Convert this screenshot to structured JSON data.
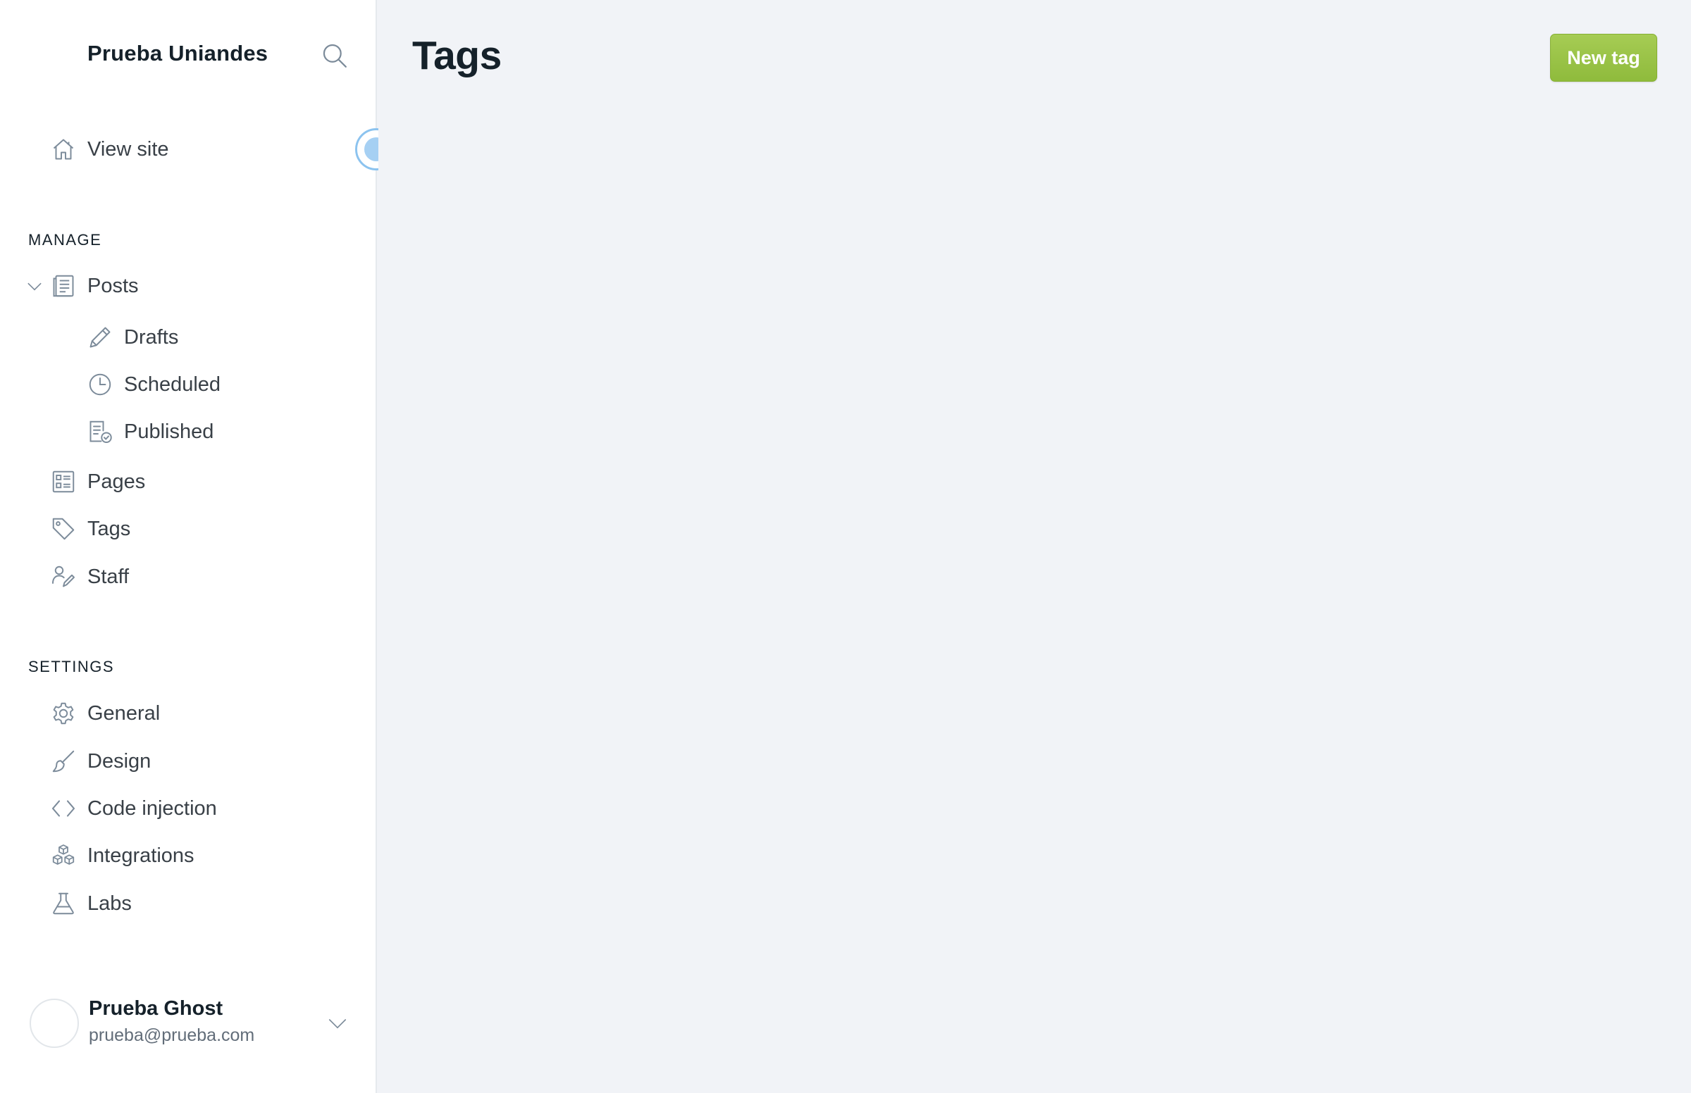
{
  "sidebar": {
    "site_title": "Prueba Uniandes",
    "view_site": "View site",
    "manage_label": "MANAGE",
    "posts": "Posts",
    "drafts": "Drafts",
    "scheduled": "Scheduled",
    "published": "Published",
    "pages": "Pages",
    "tags": "Tags",
    "staff": "Staff",
    "settings_label": "SETTINGS",
    "general": "General",
    "design": "Design",
    "code_injection": "Code injection",
    "integrations": "Integrations",
    "labs": "Labs"
  },
  "user": {
    "name": "Prueba Ghost",
    "email": "prueba@prueba.com"
  },
  "main": {
    "title": "Tags",
    "new_tag_button": "New tag"
  },
  "colors": {
    "accent_green": "#9bc445",
    "sidebar_bg": "#ffffff",
    "main_bg": "#f1f3f7",
    "toggle_blue": "#a6d0f3"
  },
  "icons": {
    "search": "search-icon",
    "view_site": "home-icon",
    "posts": "document-icon",
    "drafts": "pencil-icon",
    "scheduled": "clock-icon",
    "published": "published-doc-icon",
    "pages": "pages-icon",
    "tags": "tag-icon",
    "staff": "staff-icon",
    "general": "gear-icon",
    "design": "brush-icon",
    "code_injection": "code-icon",
    "integrations": "cubes-icon",
    "labs": "flask-icon"
  }
}
